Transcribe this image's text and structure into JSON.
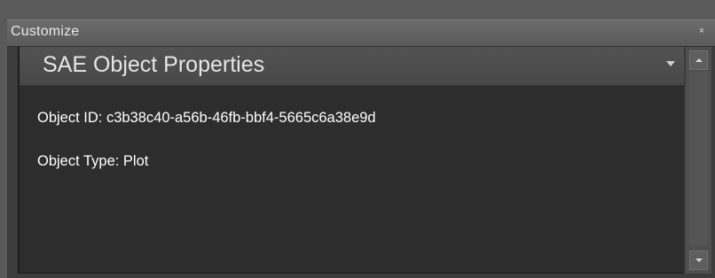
{
  "window": {
    "title": "Customize",
    "close_glyph": "×"
  },
  "panel": {
    "title": "SAE Object Properties",
    "properties": [
      {
        "label": "Object ID",
        "value": "c3b38c40-a56b-46fb-bbf4-5665c6a38e9d"
      },
      {
        "label": "Object Type",
        "value": "Plot"
      }
    ],
    "id_line": "Object ID: c3b38c40-a56b-46fb-bbf4-5665c6a38e9d",
    "type_line": "Object Type: Plot"
  },
  "icons": {
    "close": "close-icon",
    "dropdown": "chevron-down-icon",
    "scroll_up": "scroll-up-icon",
    "scroll_down": "scroll-down-icon"
  },
  "colors": {
    "titlebar": "#5f5f5f",
    "panel_header": "#4c4c4c",
    "panel_body": "#2d2d2d",
    "text": "#ffffff"
  }
}
